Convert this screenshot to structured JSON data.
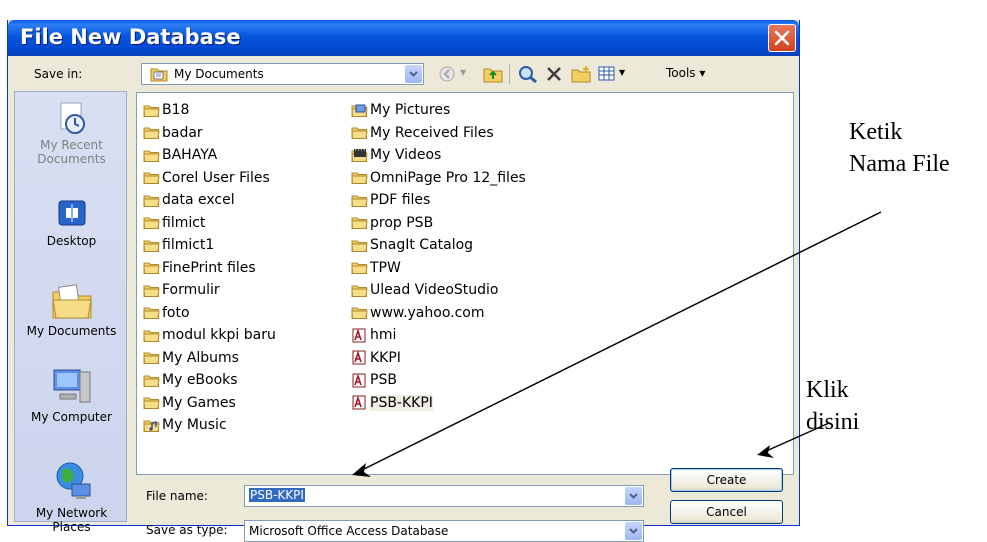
{
  "dialog": {
    "title": "File New Database",
    "close_icon": "close-x-icon",
    "save_in": {
      "label": "Save in:",
      "value": "My Documents",
      "icon": "my-documents-icon"
    },
    "toolbar": {
      "icons": [
        "back-icon",
        "up-folder-icon",
        "search-web-icon",
        "delete-icon",
        "new-folder-icon",
        "views-icon"
      ],
      "tools_label": "Tools ▾"
    },
    "places": [
      {
        "label": "My Recent Documents",
        "icon": "recent-documents-icon"
      },
      {
        "label": "Desktop",
        "icon": "desktop-icon"
      },
      {
        "label": "My Documents",
        "icon": "my-documents-icon"
      },
      {
        "label": "My Computer",
        "icon": "computer-icon"
      },
      {
        "label": "My Network Places",
        "icon": "network-icon"
      }
    ],
    "files_col1": [
      {
        "name": "B18",
        "icon": "folder-icon"
      },
      {
        "name": "badar",
        "icon": "folder-icon"
      },
      {
        "name": "BAHAYA",
        "icon": "folder-icon"
      },
      {
        "name": "Corel User Files",
        "icon": "folder-icon"
      },
      {
        "name": "data excel",
        "icon": "folder-icon"
      },
      {
        "name": "filmict",
        "icon": "folder-icon"
      },
      {
        "name": "filmict1",
        "icon": "folder-icon"
      },
      {
        "name": "FinePrint files",
        "icon": "folder-icon"
      },
      {
        "name": "Formulir",
        "icon": "folder-icon"
      },
      {
        "name": "foto",
        "icon": "folder-icon"
      },
      {
        "name": "modul kkpi baru",
        "icon": "folder-icon"
      },
      {
        "name": "My Albums",
        "icon": "folder-icon"
      },
      {
        "name": "My eBooks",
        "icon": "folder-icon"
      },
      {
        "name": "My Games",
        "icon": "folder-icon"
      },
      {
        "name": "My Music",
        "icon": "music-folder-icon"
      }
    ],
    "files_col2": [
      {
        "name": "My Pictures",
        "icon": "pictures-folder-icon"
      },
      {
        "name": "My Received Files",
        "icon": "folder-icon"
      },
      {
        "name": "My Videos",
        "icon": "videos-folder-icon"
      },
      {
        "name": "OmniPage Pro 12_files",
        "icon": "folder-icon"
      },
      {
        "name": "PDF files",
        "icon": "folder-icon"
      },
      {
        "name": "prop PSB",
        "icon": "folder-icon"
      },
      {
        "name": "SnagIt Catalog",
        "icon": "folder-icon"
      },
      {
        "name": "TPW",
        "icon": "folder-icon"
      },
      {
        "name": "Ulead VideoStudio",
        "icon": "folder-icon"
      },
      {
        "name": "www.yahoo.com",
        "icon": "folder-icon"
      },
      {
        "name": "hmi",
        "icon": "access-db-icon"
      },
      {
        "name": "KKPI",
        "icon": "access-db-icon"
      },
      {
        "name": "PSB",
        "icon": "access-db-icon"
      },
      {
        "name": "PSB-KKPI",
        "icon": "access-db-icon"
      }
    ],
    "file_name": {
      "label": "File name:",
      "value": "PSB-KKPI"
    },
    "save_as_type": {
      "label": "Save as type:",
      "value": "Microsoft Office Access Database"
    },
    "buttons": {
      "create": "Create",
      "cancel": "Cancel"
    }
  },
  "annotations": {
    "type_name": [
      "Ketik",
      "Nama File"
    ],
    "click_here": [
      "Klik",
      "disini"
    ]
  },
  "colors": {
    "titlebar": "#0855dd",
    "dialog_bg": "#ece9d8",
    "selection": "#316ac5",
    "close_button": "#d1421e"
  }
}
